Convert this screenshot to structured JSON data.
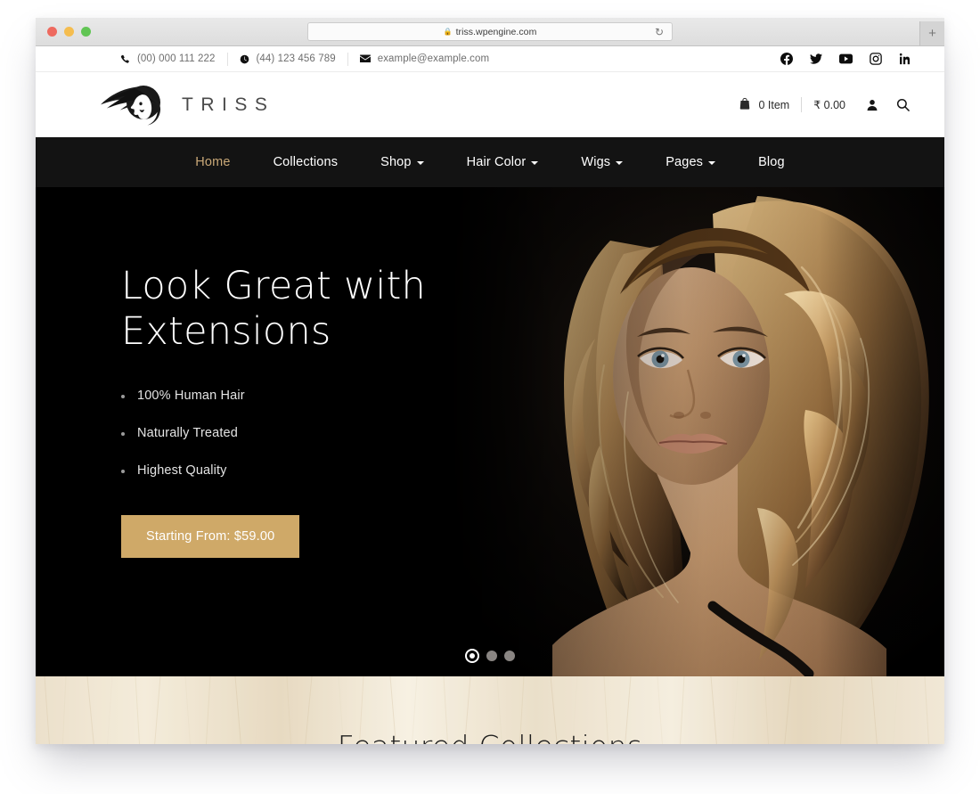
{
  "browser": {
    "url": "triss.wpengine.com",
    "lock_icon": "lock-icon",
    "reload_icon": "reload-icon",
    "new_tab_label": "+"
  },
  "topbar": {
    "contacts": [
      {
        "icon": "phone-icon",
        "text": "(00) 000 111 222"
      },
      {
        "icon": "clock-icon",
        "text": "(44) 123 456 789"
      },
      {
        "icon": "envelope-icon",
        "text": "example@example.com"
      }
    ],
    "social": [
      {
        "name": "facebook-icon"
      },
      {
        "name": "twitter-icon"
      },
      {
        "name": "youtube-icon"
      },
      {
        "name": "instagram-icon"
      },
      {
        "name": "linkedin-icon"
      }
    ]
  },
  "header": {
    "logo_text": "TRISS",
    "cart_count": "0 Item",
    "cart_total": "₹ 0.00",
    "account_icon": "user-icon",
    "search_icon": "search-icon"
  },
  "nav": {
    "items": [
      {
        "label": "Home",
        "active": true,
        "dropdown": false
      },
      {
        "label": "Collections",
        "active": false,
        "dropdown": false
      },
      {
        "label": "Shop",
        "active": false,
        "dropdown": true
      },
      {
        "label": "Hair Color",
        "active": false,
        "dropdown": true
      },
      {
        "label": "Wigs",
        "active": false,
        "dropdown": true
      },
      {
        "label": "Pages",
        "active": false,
        "dropdown": true
      },
      {
        "label": "Blog",
        "active": false,
        "dropdown": false
      }
    ]
  },
  "hero": {
    "title_line1": "Look Great with",
    "title_line2": "Extensions",
    "bullets": [
      "100% Human Hair",
      "Naturally Treated",
      "Highest Quality"
    ],
    "cta_label": "Starting From: $59.00",
    "slides": [
      {
        "active": true
      },
      {
        "active": false
      },
      {
        "active": false
      }
    ]
  },
  "featured": {
    "title": "Featured Collections"
  },
  "colors": {
    "accent_gold": "#cfa968",
    "nav_background": "#131313",
    "hero_background": "#000000"
  }
}
